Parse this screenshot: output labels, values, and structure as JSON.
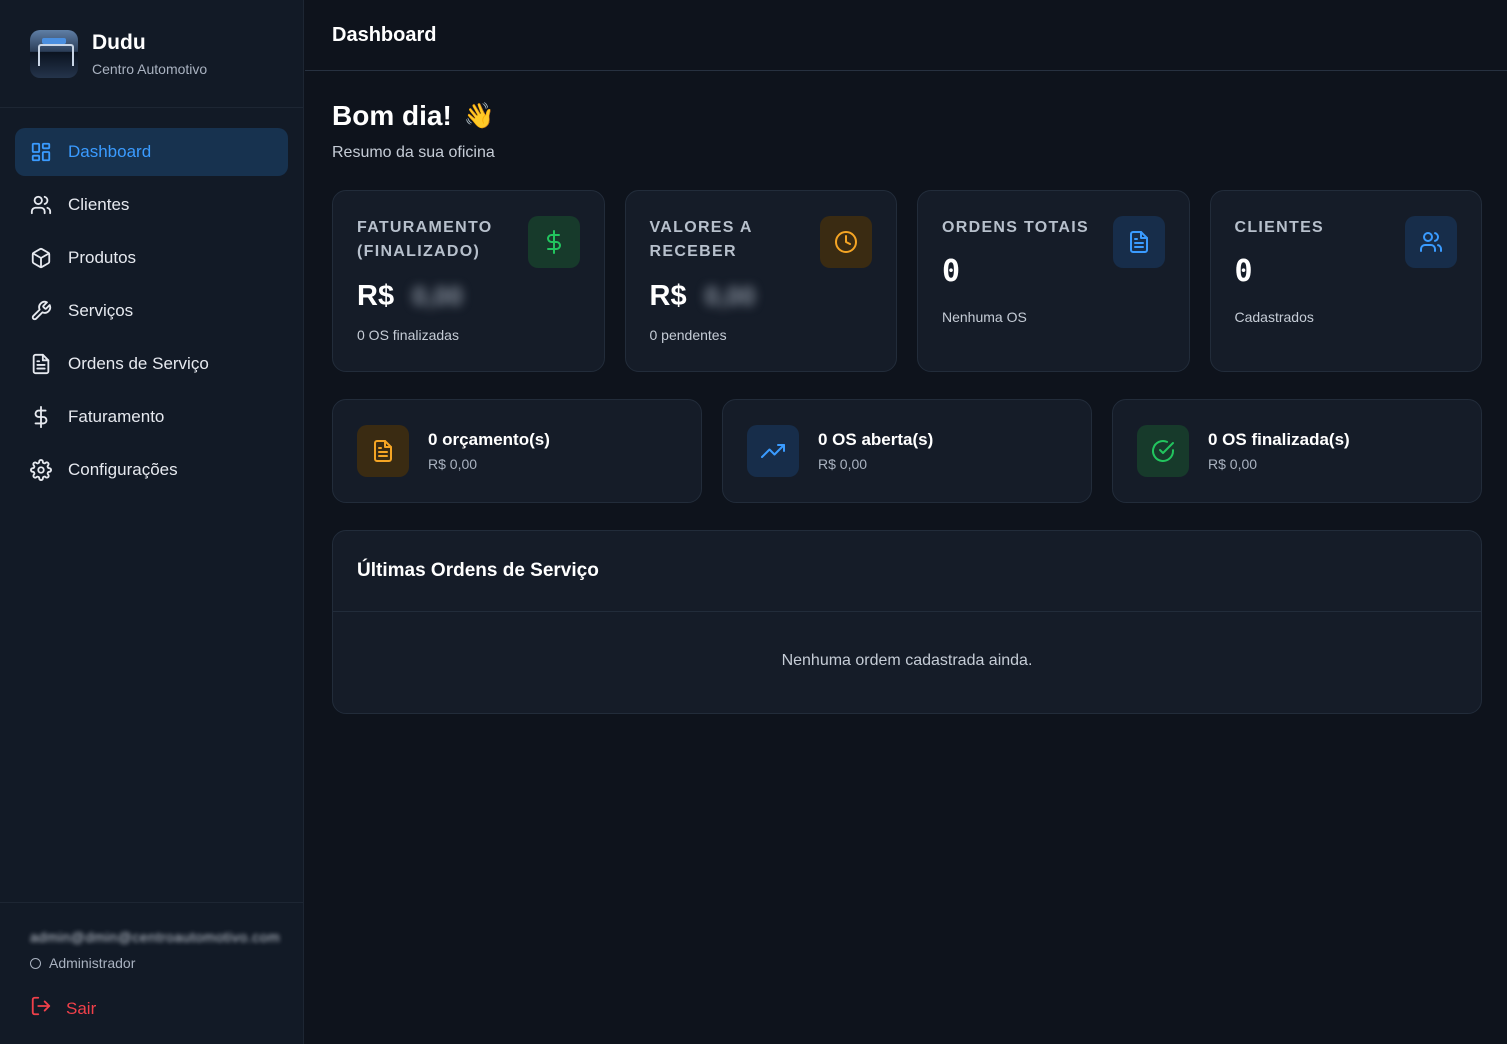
{
  "brand": {
    "name": "Dudu",
    "subtitle": "Centro Automotivo"
  },
  "sidebar": {
    "items": [
      {
        "label": "Dashboard",
        "icon": "grid-icon",
        "active": true
      },
      {
        "label": "Clientes",
        "icon": "users-icon"
      },
      {
        "label": "Produtos",
        "icon": "box-icon"
      },
      {
        "label": "Serviços",
        "icon": "wrench-icon"
      },
      {
        "label": "Ordens de Serviço",
        "icon": "file-text-icon"
      },
      {
        "label": "Faturamento",
        "icon": "dollar-icon"
      },
      {
        "label": "Configurações",
        "icon": "gear-icon"
      }
    ],
    "user": {
      "email": "admin@dmin@centroautomotivo.com",
      "role": "Administrador"
    },
    "logout_label": "Sair"
  },
  "header": {
    "title": "Dashboard"
  },
  "greeting": {
    "title": "Bom dia!",
    "emoji": "👋",
    "subtitle": "Resumo da sua oficina"
  },
  "cards": [
    {
      "title": "FATURAMENTO (FINALIZADO)",
      "currency": "R$",
      "value": "0,00",
      "footer": "0 OS finalizadas",
      "icon": "dollar-icon",
      "color": "#22c55e"
    },
    {
      "title": "VALORES A RECEBER",
      "currency": "R$",
      "value": "0,00",
      "footer": "0 pendentes",
      "icon": "clock-icon",
      "color": "#f5a524"
    },
    {
      "title": "ORDENS TOTAIS",
      "value": "0",
      "footer": "Nenhuma OS",
      "icon": "file-text-icon",
      "color": "#3a9bff"
    },
    {
      "title": "CLIENTES",
      "value": "0",
      "footer": "Cadastrados",
      "icon": "users-icon",
      "color": "#3a9bff"
    }
  ],
  "stats": [
    {
      "title": "0 orçamento(s)",
      "sub": "R$ 0,00",
      "icon": "file-text-icon",
      "color": "#f5a524"
    },
    {
      "title": "0 OS aberta(s)",
      "sub": "R$ 0,00",
      "icon": "trending-up-icon",
      "color": "#3a9bff"
    },
    {
      "title": "0 OS finalizada(s)",
      "sub": "R$ 0,00",
      "icon": "check-circle-icon",
      "color": "#22c55e"
    }
  ],
  "orders": {
    "title": "Últimas Ordens de Serviço",
    "empty": "Nenhuma ordem cadastrada ainda."
  },
  "colors": {
    "accent": "#3a9bff",
    "danger": "#f0404a",
    "background": "#0e131c",
    "panel": "#151c28"
  }
}
